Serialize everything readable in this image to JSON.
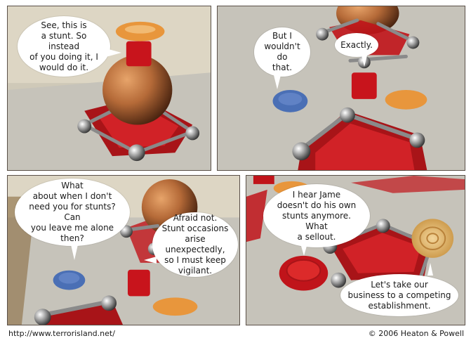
{
  "panels": [
    {
      "bubbles": [
        {
          "text": "See, this is\na stunt. So instead\nof you doing it, I\nwould do it."
        }
      ]
    },
    {
      "bubbles": [
        {
          "text": "But I\nwouldn't do\nthat."
        },
        {
          "text": "Exactly."
        }
      ]
    },
    {
      "bubbles": [
        {
          "text": "What\nabout when I don't\nneed you for stunts? Can\nyou leave me alone\nthen?"
        },
        {
          "text": "Afraid not.\nStunt occasions\narise unexpectedly,\nso I must keep\nvigilant."
        }
      ]
    },
    {
      "bubbles": [
        {
          "text": "I hear Jame\ndoesn't do his own\nstunts anymore. What\na sellout."
        },
        {
          "text": "Let's take our\nbusiness to a competing\nestablishment."
        }
      ]
    }
  ],
  "footer": {
    "url": "http://www.terrorisland.net/",
    "copyright": "© 2006 Heaton & Powell"
  },
  "colors": {
    "tablecloth": "#c9c6bc",
    "wall": "#d8d2c0",
    "copper_ball": "#b56a38",
    "red_pentagon": "#c0141a",
    "blue_chip": "#4a6fb5",
    "red_die": "#c8141c",
    "orange_gummy": "#e8963c"
  }
}
